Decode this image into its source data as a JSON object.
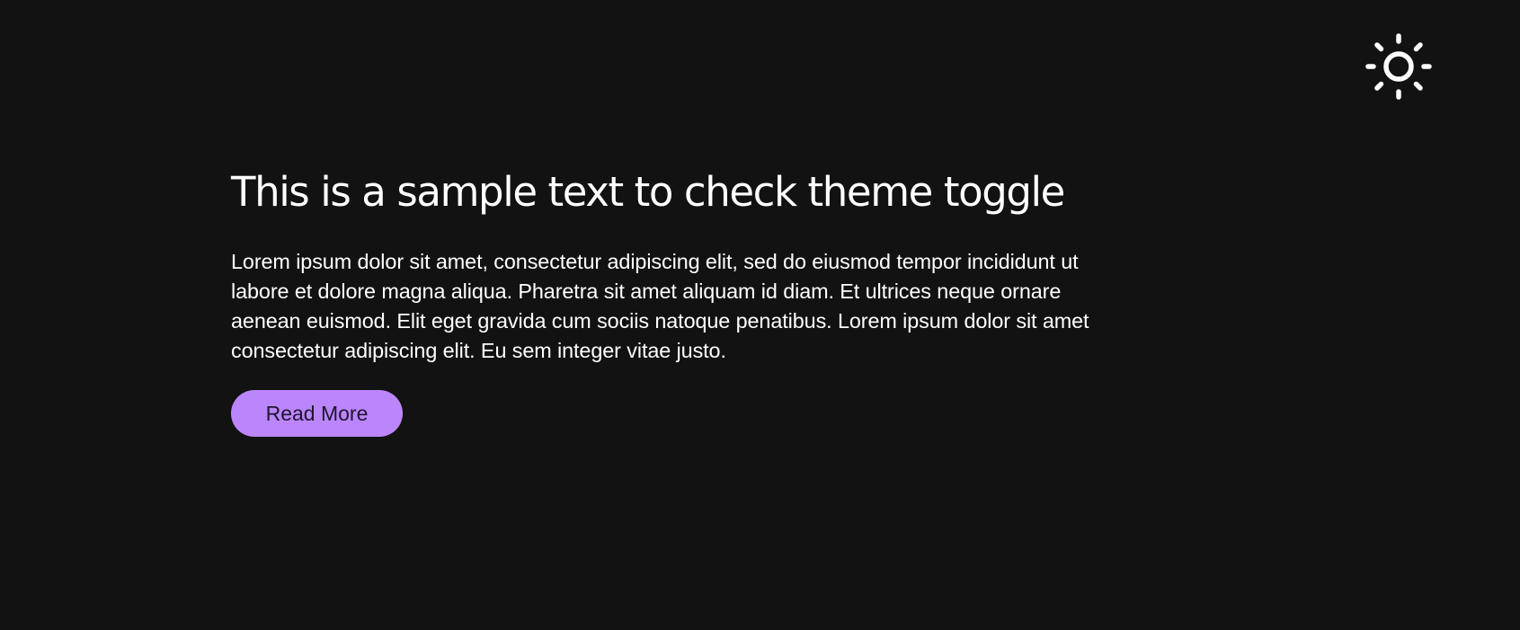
{
  "theme_toggle": {
    "icon": "sun-icon",
    "color": "#ffffff"
  },
  "main": {
    "title": "This is a sample text to check theme toggle",
    "body": "Lorem ipsum dolor sit amet, consectetur adipiscing elit, sed do eiusmod tempor incididunt ut labore et dolore magna aliqua. Pharetra sit amet aliquam id diam. Et ultrices neque ornare aenean euismod. Elit eget gravida cum sociis natoque penatibus. Lorem ipsum dolor sit amet consectetur adipiscing elit. Eu sem integer vitae justo.",
    "read_more_label": "Read More"
  },
  "colors": {
    "background": "#121212",
    "text": "#ffffff",
    "accent": "#bb86fc"
  }
}
